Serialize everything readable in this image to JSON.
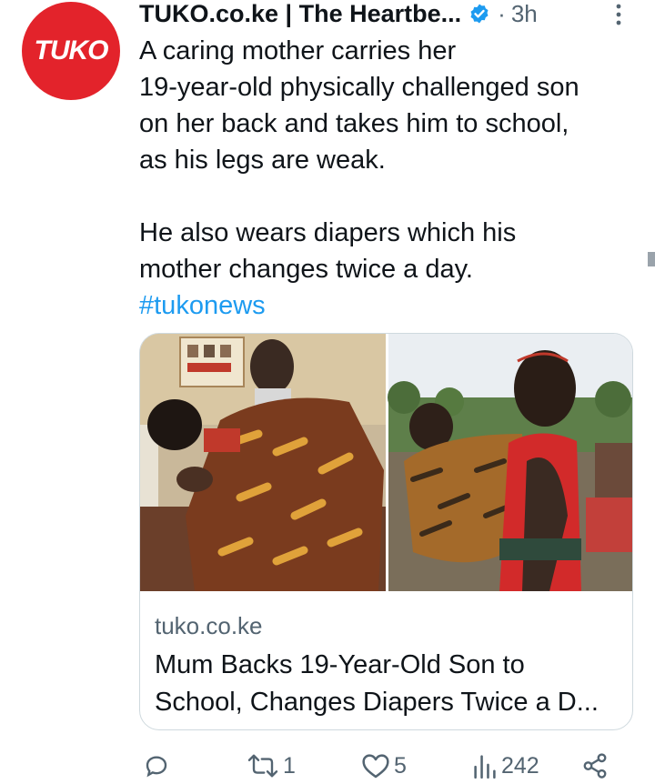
{
  "author": {
    "avatar_text": "TUKO",
    "name": "TUKO.co.ke | The Heartbe...",
    "time": "3h",
    "dot": "·"
  },
  "tweet": {
    "text_lines": [
      "A caring mother carries her",
      "19-year-old physically challenged son",
      "on her back and takes him to school,",
      "as his legs are weak."
    ],
    "text_lines_2": [
      "He also wears diapers which his",
      "mother changes twice a day."
    ],
    "hashtag": "#tukonews"
  },
  "card": {
    "domain": "tuko.co.ke",
    "title_line1": "Mum Backs 19-Year-Old Son to",
    "title_line2": "School, Changes Diapers Twice a D..."
  },
  "actions": {
    "reply_count": "",
    "retweet_count": "1",
    "like_count": "5",
    "views_count": "242"
  },
  "colors": {
    "accent": "#1d9bf0",
    "brand": "#e3232b",
    "muted": "#536471"
  },
  "icons": [
    "verified-badge-icon",
    "more-icon",
    "reply-icon",
    "retweet-icon",
    "like-icon",
    "views-icon",
    "share-icon"
  ]
}
